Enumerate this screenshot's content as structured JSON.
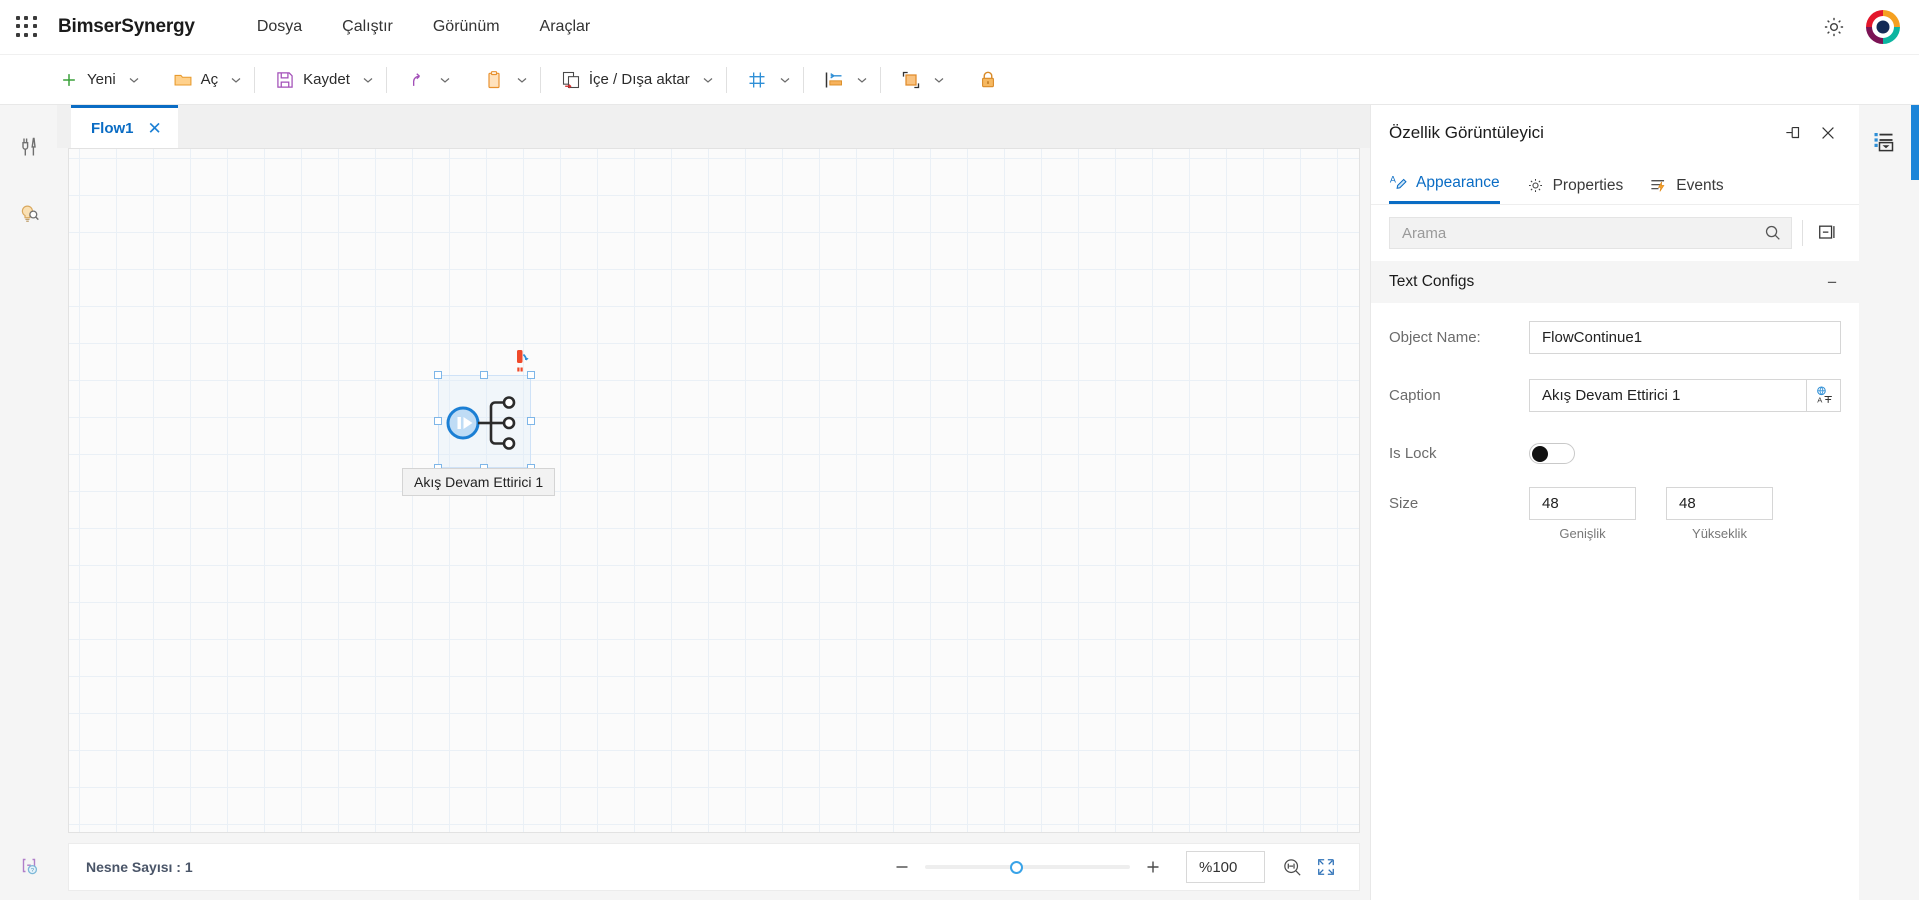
{
  "menubar": {
    "app_launcher_icon": "waffle-grid-icon",
    "brand": "BimserSynergy",
    "items": [
      {
        "label": "Dosya"
      },
      {
        "label": "Çalıştır"
      },
      {
        "label": "Görünüm"
      },
      {
        "label": "Araçlar"
      }
    ],
    "settings_icon": "gear-icon",
    "avatar_icon": "user-avatar-donut-logo"
  },
  "ribbon": {
    "buttons": [
      {
        "label": "Yeni",
        "icon": "plus-icon",
        "caret": true
      },
      {
        "label": "Aç",
        "icon": "folder-open-icon",
        "caret": true
      },
      {
        "label": "Kaydet",
        "icon": "floppy-disk-icon",
        "caret": true
      },
      {
        "label": "",
        "icon": "undo-arrow-icon",
        "caret": true
      },
      {
        "label": "",
        "icon": "clipboard-icon",
        "caret": true
      },
      {
        "label": "İçe / Dışa aktar",
        "icon": "import-export-icon",
        "caret": true
      },
      {
        "label": "",
        "icon": "grid-icon",
        "caret": true
      },
      {
        "label": "",
        "icon": "align-left-icon",
        "caret": true
      },
      {
        "label": "",
        "icon": "group-objects-icon",
        "caret": true
      },
      {
        "label": "",
        "icon": "lock-icon",
        "caret": false
      }
    ]
  },
  "left_rail": {
    "items": [
      {
        "icon": "tools-wrench-icon",
        "name": "toolbox"
      },
      {
        "icon": "lightbulb-search-icon",
        "name": "inspector"
      }
    ],
    "bottom": [
      {
        "icon": "code-help-icon",
        "name": "script-help"
      }
    ]
  },
  "editor": {
    "tabs": [
      {
        "label": "Flow1",
        "close_icon": "close-icon",
        "active": true
      }
    ],
    "canvas": {
      "node": {
        "label": "Akış Devam Ettirici 1",
        "icon": "flow-continue-play-icon",
        "rotate_icon": "rotate-handle-icon",
        "selected": true
      }
    }
  },
  "statusbar": {
    "object_count": "Nesne Sayısı : 1",
    "zoom_out_icon": "minus-icon",
    "zoom_in_icon": "plus-icon",
    "zoom_value": "%100",
    "zoom_find_icon": "zoom-fit-width-icon",
    "fit_screen_icon": "fit-to-screen-icon",
    "slider_percent": 42
  },
  "property_panel": {
    "title": "Özellik Görüntüleyici",
    "pin_icon": "pin-icon",
    "close_icon": "close-icon",
    "tabs": [
      {
        "label": "Appearance",
        "icon": "appearance-pen-icon",
        "active": true
      },
      {
        "label": "Properties",
        "icon": "gear-icon",
        "active": false
      },
      {
        "label": "Events",
        "icon": "events-lightning-icon",
        "active": false
      }
    ],
    "search": {
      "placeholder": "Arama",
      "value": "",
      "search_icon": "search-icon"
    },
    "collapse_all_icon": "collapse-all-icon",
    "section": {
      "title": "Text Configs",
      "toggle_icon": "minus-icon",
      "fields": {
        "object_name_label": "Object Name:",
        "object_name_value": "FlowContinue1",
        "caption_label": "Caption",
        "caption_value": "Akış Devam Ettirici 1",
        "caption_addon_icon": "translate-icon",
        "is_lock_label": "Is Lock",
        "is_lock_value": false,
        "size_label": "Size",
        "size_width_value": "48",
        "size_height_value": "48",
        "size_width_caption": "Genişlik",
        "size_height_caption": "Yükseklik"
      }
    }
  },
  "right_rail": {
    "items": [
      {
        "icon": "properties-panel-icon",
        "name": "properties-panel-toggle"
      }
    ]
  },
  "colors": {
    "accent": "#0a6cc4",
    "slider": "#39a3e8",
    "node_blue": "#1b7fd4",
    "rail_bg": "#f5f5f5"
  }
}
